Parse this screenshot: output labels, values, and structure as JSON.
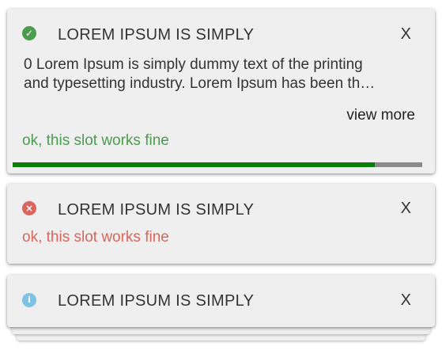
{
  "colors": {
    "success": "#4a9d4e",
    "error": "#d9655c",
    "info": "#7ec3e4",
    "progress_fill": "#0a7e07",
    "progress_track": "#8a8a8a"
  },
  "toasts": [
    {
      "type": "success",
      "icon": "check-circle-icon",
      "icon_glyph": "✓",
      "title": "LOREM IPSUM IS SIMPLY",
      "close_label": "X",
      "message_line1": "0 Lorem Ipsum is simply dummy text of the printing",
      "message_line2": "and typesetting industry. Lorem Ipsum has been th…",
      "view_more_label": "view more",
      "slot_text": "ok, this slot works fine",
      "progress": 0.884
    },
    {
      "type": "error",
      "icon": "x-circle-icon",
      "icon_glyph": "×",
      "title": "LOREM IPSUM IS SIMPLY",
      "close_label": "X",
      "slot_text": "ok, this slot works fine"
    },
    {
      "type": "info",
      "icon": "info-circle-icon",
      "icon_glyph": "i",
      "title": "LOREM IPSUM IS SIMPLY",
      "close_label": "X"
    }
  ]
}
